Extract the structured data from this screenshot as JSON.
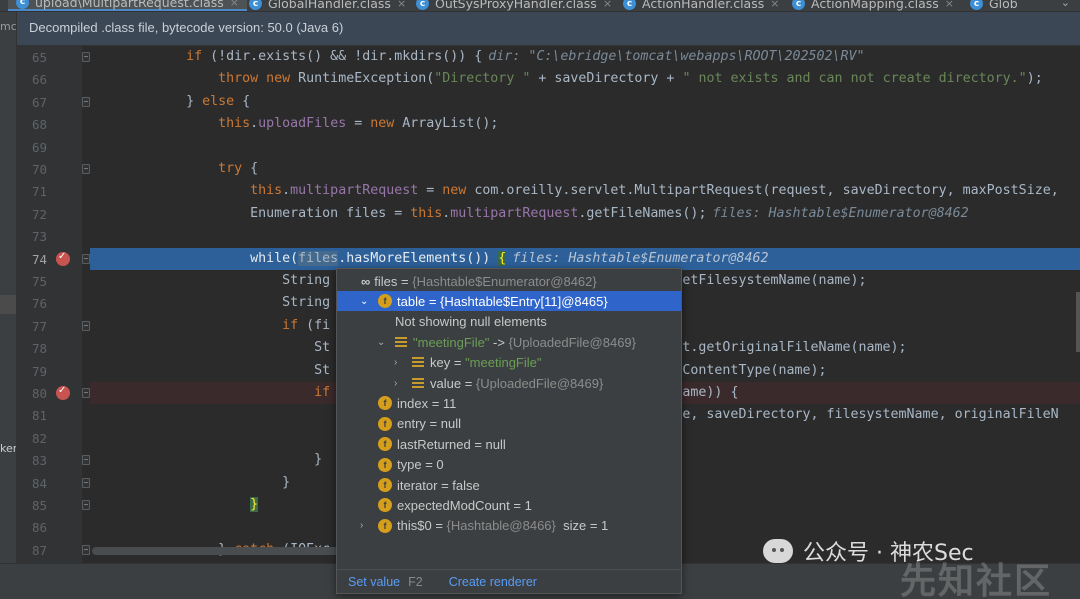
{
  "tabs": [
    {
      "label": "upload\\MultipartRequest.class",
      "active": true
    },
    {
      "label": "GlobalHandler.class"
    },
    {
      "label": "OutSysProxyHandler.class"
    },
    {
      "label": "ActionHandler.class"
    },
    {
      "label": "ActionMapping.class"
    },
    {
      "label": "Glob"
    }
  ],
  "tab_more": "⌄",
  "left_strip": {
    "top_text": "mc",
    "mid_text": "ker"
  },
  "banner": "Decompiled .class file, bytecode version: 50.0 (Java 6)",
  "current_line": 74,
  "breakpoint_lines": [
    74,
    80
  ],
  "lines": [
    {
      "n": "65",
      "parts": [
        {
          "t": "            "
        },
        {
          "t": "if",
          "c": "kw"
        },
        {
          "t": " (!dir.exists() && !dir.mkdirs()) {"
        },
        {
          "t": "dir: \"C:\\ebridge\\tomcat\\webapps\\ROOT\\202502\\RV\"",
          "c": "hint"
        }
      ]
    },
    {
      "n": "66",
      "parts": [
        {
          "t": "                "
        },
        {
          "t": "throw new",
          "c": "kw"
        },
        {
          "t": " RuntimeException("
        },
        {
          "t": "\"Directory \"",
          "c": "str"
        },
        {
          "t": " + saveDirectory + "
        },
        {
          "t": "\" not exists and can not create directory.\"",
          "c": "str"
        },
        {
          "t": ");"
        }
      ]
    },
    {
      "n": "67",
      "parts": [
        {
          "t": "            } "
        },
        {
          "t": "else",
          "c": "kw"
        },
        {
          "t": " {"
        }
      ]
    },
    {
      "n": "68",
      "parts": [
        {
          "t": "                "
        },
        {
          "t": "this",
          "c": "kw"
        },
        {
          "t": "."
        },
        {
          "t": "uploadFiles",
          "c": "fld"
        },
        {
          "t": " = "
        },
        {
          "t": "new",
          "c": "kw"
        },
        {
          "t": " ArrayList();"
        }
      ]
    },
    {
      "n": "69",
      "parts": []
    },
    {
      "n": "70",
      "parts": [
        {
          "t": "                "
        },
        {
          "t": "try",
          "c": "kw"
        },
        {
          "t": " {"
        }
      ]
    },
    {
      "n": "71",
      "parts": [
        {
          "t": "                    "
        },
        {
          "t": "this",
          "c": "kw"
        },
        {
          "t": "."
        },
        {
          "t": "multipartRequest",
          "c": "fld"
        },
        {
          "t": " = "
        },
        {
          "t": "new",
          "c": "kw"
        },
        {
          "t": " com.oreilly.servlet.MultipartRequest(request, saveDirectory, maxPostSize, "
        }
      ]
    },
    {
      "n": "72",
      "parts": [
        {
          "t": "                    Enumeration files = "
        },
        {
          "t": "this",
          "c": "kw"
        },
        {
          "t": "."
        },
        {
          "t": "multipartRequest",
          "c": "fld"
        },
        {
          "t": ".getFileNames();"
        },
        {
          "t": "files: Hashtable$Enumerator@8462",
          "c": "hint"
        }
      ]
    },
    {
      "n": "73",
      "parts": []
    },
    {
      "n": "74",
      "cur": true,
      "parts": [
        {
          "t": "                    "
        },
        {
          "t": "while",
          "c": "kwc"
        },
        {
          "t": "("
        },
        {
          "t": "files",
          "c": "var-hl"
        },
        {
          "t": ".hasMoreElements()) "
        },
        {
          "t": "{",
          "c": "brace-hl"
        },
        {
          "t": "files: Hashtable$Enumerator@8462",
          "c": "hint"
        }
      ]
    },
    {
      "n": "75",
      "parts": [
        {
          "t": "                        String                                            etFilesystemName(name);"
        }
      ]
    },
    {
      "n": "76",
      "parts": [
        {
          "t": "                        String"
        }
      ]
    },
    {
      "n": "77",
      "parts": [
        {
          "t": "                        "
        },
        {
          "t": "if",
          "c": "kw"
        },
        {
          "t": " (fi"
        }
      ]
    },
    {
      "n": "78",
      "parts": [
        {
          "t": "                            St                                          est.getOriginalFileName(name);"
        }
      ]
    },
    {
      "n": "79",
      "parts": [
        {
          "t": "                            St                                          etContentType(name);"
        }
      ]
    },
    {
      "n": "80",
      "err": true,
      "parts": [
        {
          "t": "                            "
        },
        {
          "t": "if",
          "c": "kw"
        },
        {
          "t": "                                          mName)) {"
        }
      ]
    },
    {
      "n": "81",
      "parts": [
        {
          "t": "                                                                        ame, saveDirectory, filesystemName, originalFileN"
        }
      ]
    },
    {
      "n": "82",
      "parts": []
    },
    {
      "n": "83",
      "parts": [
        {
          "t": "                            }"
        }
      ]
    },
    {
      "n": "84",
      "parts": [
        {
          "t": "                        }"
        }
      ]
    },
    {
      "n": "85",
      "parts": [
        {
          "t": "                    "
        },
        {
          "t": "}",
          "c": "brace-hl"
        }
      ]
    },
    {
      "n": "86",
      "parts": []
    },
    {
      "n": "87",
      "parts": [
        {
          "t": "                } "
        },
        {
          "t": "catch",
          "c": "kw"
        },
        {
          "t": " (IOExc"
        }
      ]
    }
  ],
  "popup": {
    "rows": [
      {
        "indent": 0,
        "arrow": "",
        "icon": "oo",
        "name": "files",
        "sep": " = ",
        "value": "{Hashtable$Enumerator@8462}",
        "vclass": "grey"
      },
      {
        "indent": 1,
        "arrow": "⌄",
        "icon": "f",
        "name": "table",
        "sep": " = ",
        "value": "{Hashtable$Entry[11]@8465}",
        "vclass": "",
        "sel": true
      },
      {
        "indent": 2,
        "arrow": "",
        "icon": "",
        "name": "Not showing null elements",
        "sep": "",
        "value": "",
        "vclass": ""
      },
      {
        "indent": 2,
        "arrow": "⌄",
        "icon": "list",
        "name": "\"meetingFile\"",
        "nclass": "greenval",
        "sep": " -> ",
        "value": "{UploadedFile@8469}",
        "vclass": "grey"
      },
      {
        "indent": 3,
        "arrow": "›",
        "icon": "list",
        "name": "key",
        "sep": " = ",
        "value": "\"meetingFile\"",
        "vclass": "greenval"
      },
      {
        "indent": 3,
        "arrow": "›",
        "icon": "list",
        "name": "value",
        "sep": " = ",
        "value": "{UploadedFile@8469}",
        "vclass": "grey"
      },
      {
        "indent": 1,
        "arrow": "",
        "icon": "f",
        "name": "index",
        "sep": " = ",
        "value": "11",
        "vclass": ""
      },
      {
        "indent": 1,
        "arrow": "",
        "icon": "f",
        "name": "entry",
        "sep": " = ",
        "value": "null",
        "vclass": ""
      },
      {
        "indent": 1,
        "arrow": "",
        "icon": "f",
        "name": "lastReturned",
        "sep": " = ",
        "value": "null",
        "vclass": ""
      },
      {
        "indent": 1,
        "arrow": "",
        "icon": "f",
        "name": "type",
        "sep": " = ",
        "value": "0",
        "vclass": ""
      },
      {
        "indent": 1,
        "arrow": "",
        "icon": "f",
        "name": "iterator",
        "sep": " = ",
        "value": "false",
        "vclass": ""
      },
      {
        "indent": 1,
        "arrow": "",
        "icon": "f",
        "name": "expectedModCount",
        "sep": " = ",
        "value": "1",
        "vclass": ""
      },
      {
        "indent": 1,
        "arrow": "›",
        "icon": "f",
        "name": "this$0",
        "sep": " = ",
        "value": "{Hashtable@8466}",
        "vclass": "grey",
        "extra": "  size = 1"
      }
    ],
    "set_value_label": "Set value",
    "set_value_key": "F2",
    "create_renderer_label": "Create renderer"
  },
  "watermark": {
    "text": "公众号 · 神农Sec",
    "faint": "先知社区"
  }
}
